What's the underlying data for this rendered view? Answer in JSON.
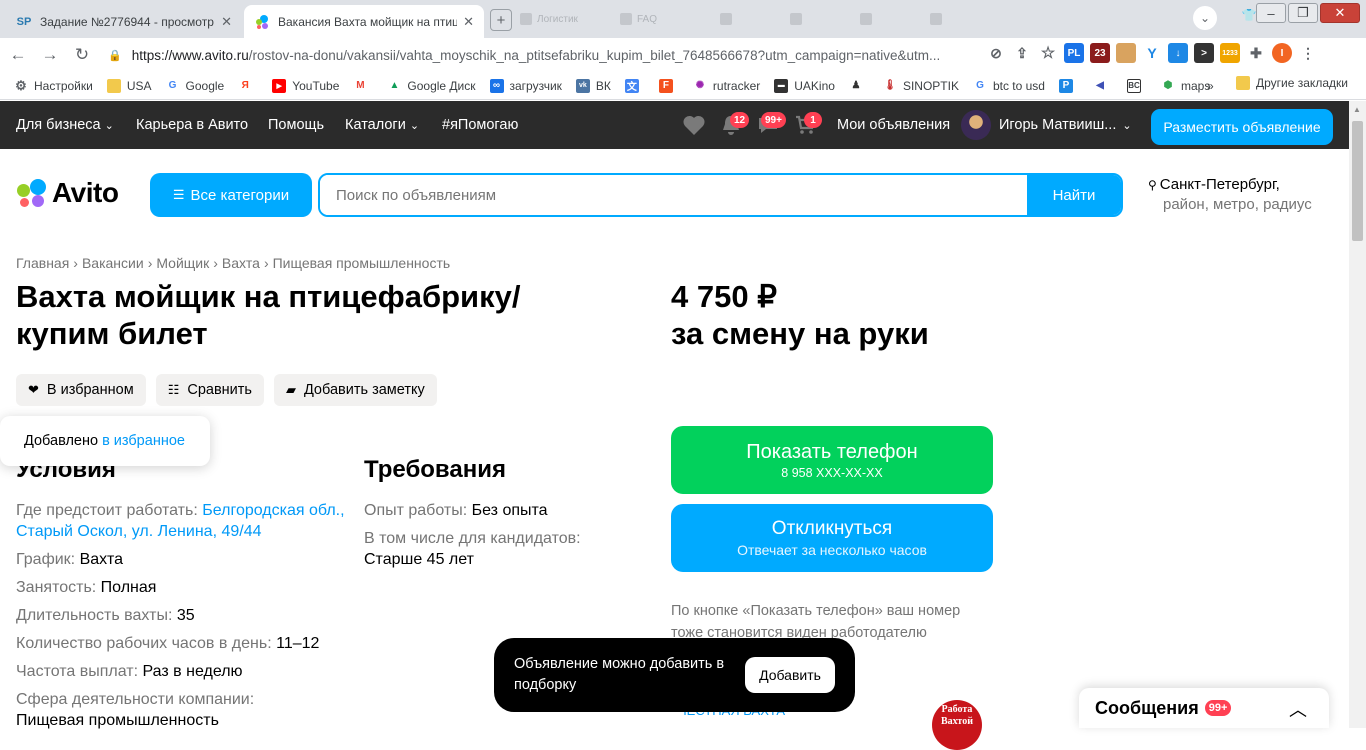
{
  "browser": {
    "tabs": [
      {
        "favicon": "SP",
        "title": "Задание №2776944 - просмотр з",
        "active": false
      },
      {
        "favicon": "avito-icon",
        "title": "Вакансия Вахта мойщик на птице",
        "active": true
      }
    ],
    "ghost_tabs": [
      "Логистик",
      "FAQ",
      "",
      "",
      "",
      "",
      "",
      ""
    ],
    "url_host": "https://www.avito.ru",
    "url_path": "/rostov-na-donu/vakansii/vahta_moyschik_na_ptitsefabriku_kupim_bilet_7648566678?utm_campaign=native&utm...",
    "extensions": [
      {
        "icon": "vpn-icon",
        "label": "",
        "color": "#555"
      },
      {
        "icon": "globe-pl-icon",
        "label": "PL",
        "color": "#1a73e8"
      },
      {
        "icon": "ext-23-icon",
        "label": "23",
        "color": "#8b1c1c"
      },
      {
        "icon": "face-icon",
        "label": "",
        "color": "#d9a35f"
      },
      {
        "icon": "y-icon",
        "label": "Y",
        "color": "#1e88e5"
      },
      {
        "icon": "download-icon",
        "label": "↓",
        "color": "#1e88e5"
      },
      {
        "icon": "terminal-icon",
        "label": ">",
        "color": "#333"
      },
      {
        "icon": "coin-icon",
        "label": "1233",
        "color": "#f0a500"
      },
      {
        "icon": "puzzle-icon",
        "label": "",
        "color": "#5f6368"
      },
      {
        "icon": "profile-icon",
        "label": "I",
        "color": "#f26522"
      }
    ],
    "bookmarks": [
      {
        "icon": "gear-icon",
        "label": "Настройки",
        "color": "#5f6368"
      },
      {
        "icon": "folder-icon",
        "label": "USA",
        "color": "#f2c94c"
      },
      {
        "icon": "google-icon",
        "label": "Google",
        "color": "#4285f4"
      },
      {
        "icon": "yandex-icon",
        "label": "",
        "color": "#fc3f1d"
      },
      {
        "icon": "youtube-icon",
        "label": "YouTube",
        "color": "#ff0000"
      },
      {
        "icon": "gmail-icon",
        "label": "",
        "color": "#ea4335"
      },
      {
        "icon": "gdrive-icon",
        "label": "Google Диск",
        "color": "#0f9d58"
      },
      {
        "icon": "infinity-icon",
        "label": "загрузчик",
        "color": "#1a73e8"
      },
      {
        "icon": "vk-icon",
        "label": "ВК",
        "color": "#4c75a3"
      },
      {
        "icon": "translate-icon",
        "label": "",
        "color": "#4285f4"
      },
      {
        "icon": "f-icon",
        "label": "",
        "color": "#f4511e"
      },
      {
        "icon": "rutracker-icon",
        "label": "rutracker",
        "color": "#9c27b0"
      },
      {
        "icon": "uakino-icon",
        "label": "UAKino",
        "color": "#333"
      },
      {
        "icon": "piece-icon",
        "label": "",
        "color": "#333"
      },
      {
        "icon": "thermometer-icon",
        "label": "SINOPTIK",
        "color": "#c62828"
      },
      {
        "icon": "google-icon",
        "label": "btc to usd",
        "color": "#4285f4"
      },
      {
        "icon": "p-icon",
        "label": "",
        "color": "#1e88e5"
      },
      {
        "icon": "arrow-icon",
        "label": "",
        "color": "#3f51b5"
      },
      {
        "icon": "bc-icon",
        "label": "",
        "color": "#333"
      },
      {
        "icon": "maps-icon",
        "label": "maps",
        "color": "#34a853"
      }
    ],
    "bookmarks_more": "»",
    "other_bookmarks": "Другие закладки"
  },
  "topnav": {
    "business": "Для бизнеса",
    "career": "Карьера в Авито",
    "help": "Помощь",
    "catalogs": "Каталоги",
    "ihelp": "#яПомогаю",
    "notifications_badge": "12",
    "messages_badge": "99+",
    "cart_badge": "1",
    "my_ads": "Мои объявления",
    "user_name": "Игорь Матвииш...",
    "post_ad": "Разместить объявление"
  },
  "search": {
    "logo_text": "Avito",
    "categories_button": "Все категории",
    "placeholder": "Поиск по объявлениям",
    "find_button": "Найти",
    "city": "Санкт-Петербург,",
    "location_sub": "район, метро, радиус"
  },
  "breadcrumb": [
    "Главная",
    "Вакансии",
    "Мойщик",
    "Вахта",
    "Пищевая промышленность"
  ],
  "ad": {
    "title": "Вахта мойщик на птицефабрику/ купим билет",
    "price": "4 750 ₽",
    "price_note": "за смену на руки"
  },
  "actions": {
    "favorite": "В избранном",
    "compare": "Сравнить",
    "note": "Добавить заметку"
  },
  "toast_favorite": {
    "text": "Добавлено",
    "link": "в избранное"
  },
  "conditions": {
    "heading": "Условия",
    "rows": [
      {
        "k": "Где предстоит работать:",
        "v": "Белгородская обл., Старый Оскол, ул. Ленина, 49/44"
      },
      {
        "k": "График:",
        "v": "Вахта"
      },
      {
        "k": "Занятость:",
        "v": "Полная"
      },
      {
        "k": "Длительность вахты:",
        "v": "35"
      },
      {
        "k": "Количество рабочих часов в день:",
        "v": "11–12"
      },
      {
        "k": "Частота выплат:",
        "v": "Раз в неделю"
      },
      {
        "k": "Сфера деятельности компании:",
        "v": "Пищевая промышленность"
      }
    ]
  },
  "requirements": {
    "heading": "Требования",
    "rows": [
      {
        "k": "Опыт работы:",
        "v": "Без опыта"
      },
      {
        "k": "В том числе для кандидатов:",
        "v": "Старше 45 лет"
      }
    ]
  },
  "contact": {
    "phone_title": "Показать телефон",
    "phone_masked": "8 958 XXX-XX-XX",
    "reply_title": "Откликнуться",
    "reply_sub": "Отвечает за несколько часов",
    "note": "По кнопке «Показать телефон» ваш номер тоже становится виден работодателю"
  },
  "toast_add": {
    "text": "Объявление можно добавить в подборку",
    "button": "Добавить"
  },
  "seller": {
    "name_peek": "ЧЕСТНАЯ ВАХТА",
    "logo_text": "Работа Вахтой"
  },
  "messages_panel": {
    "title": "Сообщения",
    "badge": "99+"
  },
  "colors": {
    "avito_blue": "#00aaff",
    "avito_green": "#02d15c",
    "nav_dark": "#2b2b2b",
    "badge_red": "#ff4053"
  }
}
